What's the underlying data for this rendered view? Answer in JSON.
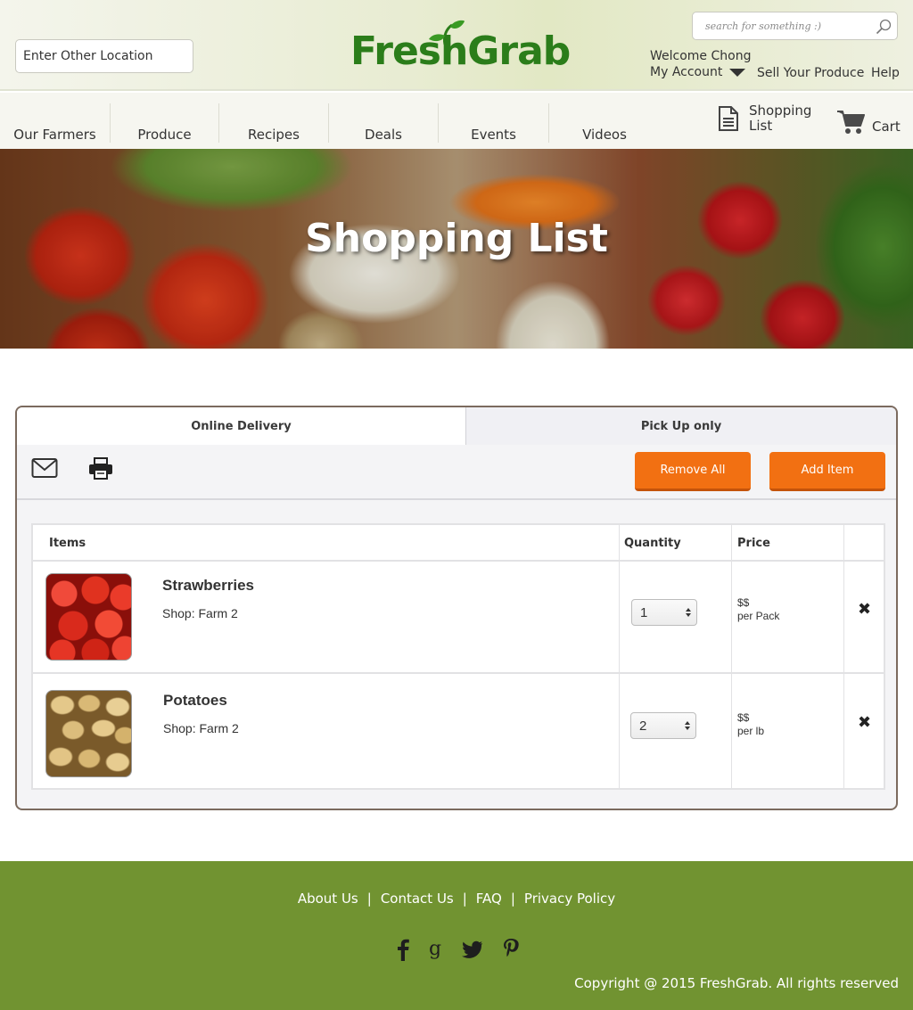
{
  "header": {
    "location_placeholder": "Enter Other Location",
    "logo_text": "FreshGrab",
    "search_placeholder": "search for something :)",
    "welcome": "Welcome Chong",
    "account": "My Account",
    "sell_link": "Sell Your Produce",
    "help_link": "Help",
    "brand_color": "#2b7d1a"
  },
  "nav": {
    "items": [
      "Our Farmers",
      "Produce",
      "Recipes",
      "Deals",
      "Events",
      "Videos"
    ],
    "shopping_list_line1": "Shopping",
    "shopping_list_line2": "List",
    "cart": "Cart"
  },
  "hero": {
    "title": "Shopping List"
  },
  "panel": {
    "tabs": [
      "Online Delivery",
      "Pick Up only"
    ],
    "active_tab": "Online Delivery",
    "toolbar": {
      "email_icon": "envelope-icon",
      "print_icon": "printer-icon",
      "remove_all": "Remove All",
      "add_item": "Add Item",
      "accent_color": "#f27012"
    },
    "table": {
      "headers": [
        "Items",
        "Quantity",
        "Price"
      ],
      "rows": [
        {
          "name": "Strawberries",
          "shop": "Shop: Farm 2",
          "quantity": "1",
          "price": "$$",
          "unit": "per Pack",
          "image": "strawberries-thumbnail"
        },
        {
          "name": "Potatoes",
          "shop": "Shop: Farm 2",
          "quantity": "2",
          "price": "$$",
          "unit": "per lb",
          "image": "potatoes-thumbnail"
        }
      ],
      "remove_glyph": "✖"
    }
  },
  "footer": {
    "links": [
      "About Us",
      "Contact Us",
      "FAQ",
      "Privacy Policy"
    ],
    "separator": "|",
    "social": [
      "facebook-icon",
      "google-plus-icon",
      "twitter-icon",
      "pinterest-icon"
    ],
    "copyright": "Copyright @ 2015 FreshGrab. All rights reserved",
    "background_color": "#719331"
  }
}
